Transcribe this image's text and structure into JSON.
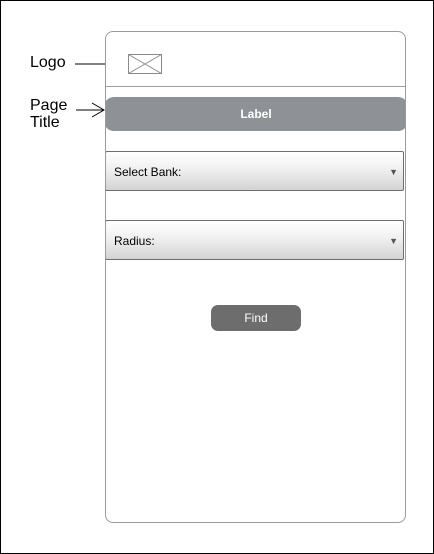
{
  "annotations": {
    "logo_label": "Logo",
    "page_title_label_line1": "Page",
    "page_title_label_line2": "Title"
  },
  "header": {
    "logo_icon": "image-placeholder-icon"
  },
  "title_bar": {
    "label": "Label"
  },
  "form": {
    "bank_select": {
      "label": "Select Bank:",
      "caret_icon": "triangle-down-icon"
    },
    "radius_select": {
      "label": "Radius:",
      "caret_icon": "triangle-down-icon"
    },
    "find_button_label": "Find"
  },
  "colors": {
    "title_bar_bg": "#8e9196",
    "button_bg": "#6d6d6d",
    "border": "#9a9a9a"
  }
}
